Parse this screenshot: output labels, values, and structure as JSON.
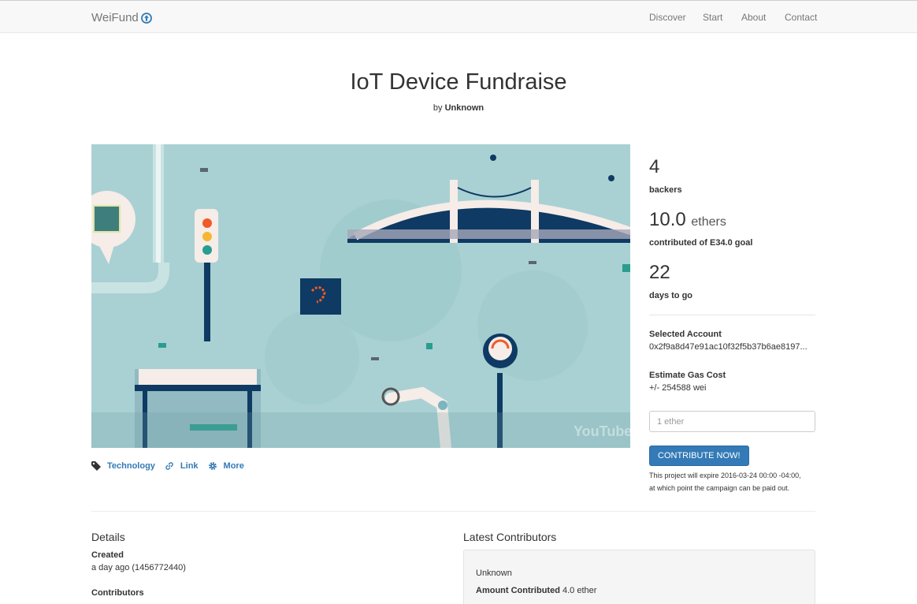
{
  "navbar": {
    "brand": "WeiFund",
    "links": [
      "Discover",
      "Start",
      "About",
      "Contact"
    ]
  },
  "campaign": {
    "title": "IoT Device Fundraise",
    "by_prefix": "by",
    "owner": "Unknown",
    "video_watermark": "YouTube"
  },
  "tags": {
    "category": "Technology",
    "link": "Link",
    "more": "More"
  },
  "stats": {
    "backers": "4",
    "backers_label": "backers",
    "contributed": "10.0",
    "contributed_unit": "ethers",
    "contributed_label": "contributed of E34.0 goal",
    "days": "22",
    "days_label": "days to go"
  },
  "account": {
    "selected_label": "Selected Account",
    "selected_value": "0x2f9a8d47e91ac10f32f5b37b6ae8197...",
    "gas_label": "Estimate Gas Cost",
    "gas_value": "+/- 254588 wei"
  },
  "contribute": {
    "placeholder": "1 ether",
    "button": "CONTRIBUTE NOW!",
    "note_line1": "This project will expire 2016-03-24 00:00 -04:00,",
    "note_line2": "at which point the campaign can be paid out."
  },
  "details": {
    "title": "Details",
    "created_label": "Created",
    "created_value": "a day ago (1456772440)",
    "contributors_label": "Contributors"
  },
  "latest": {
    "title": "Latest Contributors",
    "name": "Unknown",
    "amount_label": "Amount Contributed",
    "amount_value": "4.0 ether"
  },
  "colors": {
    "accent": "#337ab7",
    "video_bg": "#a9d1d3",
    "navy": "#0e3a63",
    "orange": "#f05a28"
  }
}
